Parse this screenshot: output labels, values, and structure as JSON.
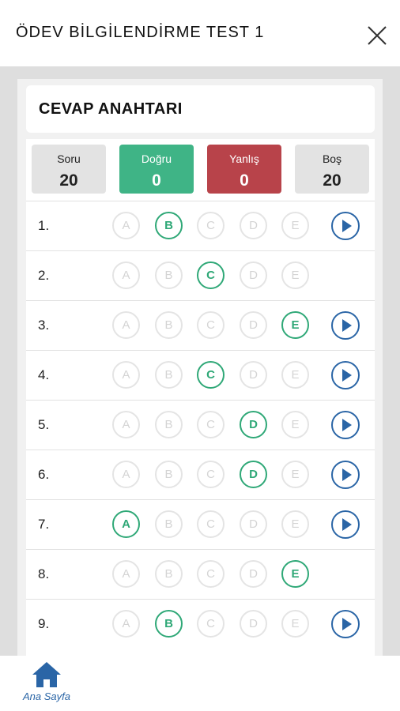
{
  "header": {
    "title": "ÖDEV BİLGİLENDİRME TEST 1",
    "close_icon": "close-icon"
  },
  "answer_key": {
    "title": "CEVAP ANAHTARI"
  },
  "stats": [
    {
      "label": "Soru",
      "value": "20"
    },
    {
      "label": "Doğru",
      "value": "0",
      "color": "#3fb486"
    },
    {
      "label": "Yanlış",
      "value": "0",
      "color": "#b8434a"
    },
    {
      "label": "Boş",
      "value": "20"
    }
  ],
  "options": [
    "A",
    "B",
    "C",
    "D",
    "E"
  ],
  "questions": [
    {
      "number": "1.",
      "correct": "B",
      "has_video": true
    },
    {
      "number": "2.",
      "correct": "C",
      "has_video": false
    },
    {
      "number": "3.",
      "correct": "E",
      "has_video": true
    },
    {
      "number": "4.",
      "correct": "C",
      "has_video": true
    },
    {
      "number": "5.",
      "correct": "D",
      "has_video": true
    },
    {
      "number": "6.",
      "correct": "D",
      "has_video": true
    },
    {
      "number": "7.",
      "correct": "A",
      "has_video": true
    },
    {
      "number": "8.",
      "correct": "E",
      "has_video": false
    },
    {
      "number": "9.",
      "correct": "B",
      "has_video": true
    }
  ],
  "bottom_nav": {
    "home_label": "Ana Sayfa",
    "home_icon": "home-icon"
  },
  "colors": {
    "correct": "#2fa877",
    "play": "#2a65a6",
    "nav": "#2a65a6"
  }
}
